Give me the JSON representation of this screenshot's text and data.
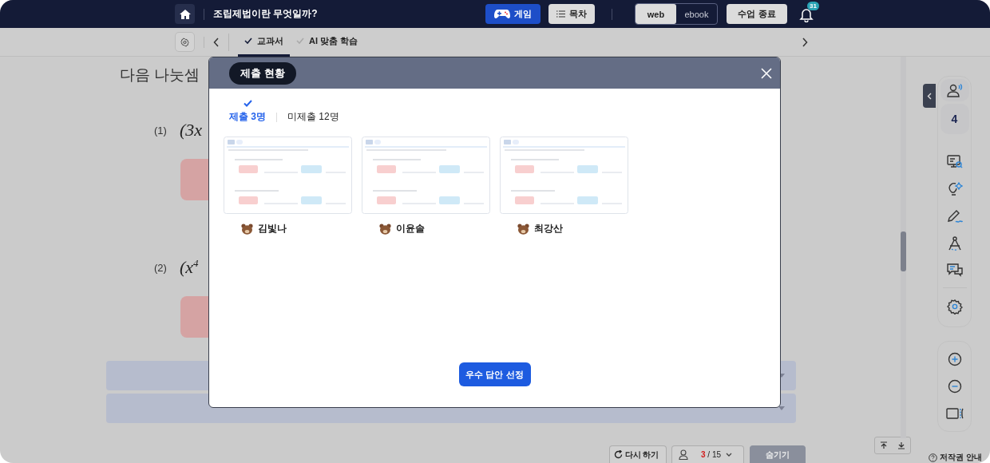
{
  "header": {
    "title": "조립제법이란 무엇일까?",
    "buttons": [
      {
        "label": "게임",
        "kind": "game"
      },
      {
        "label": "목차",
        "kind": "toc"
      }
    ],
    "view_toggle": [
      {
        "label": "web",
        "selected": true
      },
      {
        "label": "ebook",
        "selected": false
      }
    ],
    "end_button": "수업 종료",
    "notification_count": "31"
  },
  "toolbar": {
    "tabs": [
      {
        "label": "교과서",
        "selected": true
      },
      {
        "label": "AI 맞춤 학습",
        "selected": false
      }
    ]
  },
  "question": {
    "prompt": "다음 나눗셈",
    "items": [
      {
        "number": "(1)",
        "expression": "(3x"
      },
      {
        "number": "(2)",
        "expression": "(x$^{4}$"
      }
    ]
  },
  "side_panel": {
    "count": "4"
  },
  "bottom_bar": {
    "retry": "다시 하기",
    "page_current": "3",
    "page_total": "/ 15",
    "hide": "숨기기",
    "copyright": "저작권 안내"
  },
  "modal": {
    "title": "제출 현황",
    "tabs": [
      {
        "label": "제출 3명",
        "selected": true
      },
      {
        "label": "미제출 12명",
        "selected": false
      }
    ],
    "submissions": [
      {
        "name": "김빛나"
      },
      {
        "name": "이윤솔"
      },
      {
        "name": "최강산"
      }
    ],
    "action": "우수 답안 선정"
  }
}
